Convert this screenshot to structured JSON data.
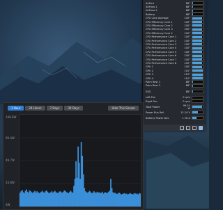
{
  "sensors_panel": {
    "rows": [
      {
        "label": "AirPort",
        "value": "88°",
        "level": 0.05
      },
      {
        "label": "AirFlow 1",
        "value": "88°",
        "level": 0.05
      },
      {
        "label": "AirFlow 2",
        "value": "88°",
        "level": 0.05
      },
      {
        "label": "Battery",
        "value": "88°",
        "level": 0.05
      },
      {
        "label": "CPU Core Average",
        "value": "100°",
        "level": 0.95
      },
      {
        "label": "CPU Efficiency Core 1",
        "value": "100°",
        "level": 0.95
      },
      {
        "label": "CPU Efficiency Core 2",
        "value": "100°",
        "level": 0.95
      },
      {
        "label": "CPU Efficiency Core 3",
        "value": "100°",
        "level": 0.95
      },
      {
        "label": "CPU Efficiency Core 4",
        "value": "100°",
        "level": 0.95
      },
      {
        "label": "CPU Performance Core 1",
        "value": "100°",
        "level": 0.95
      },
      {
        "label": "CPU Performance Core 2",
        "value": "100°",
        "level": 0.95
      },
      {
        "label": "CPU Performance Core 3",
        "value": "100°",
        "level": 0.95
      },
      {
        "label": "CPU Performance Core 4",
        "value": "100°",
        "level": 0.95
      },
      {
        "label": "CPU Performance Core 5",
        "value": "100°",
        "level": 0.95
      },
      {
        "label": "CPU Performance Core 6",
        "value": "100°",
        "level": 0.95
      },
      {
        "label": "CPU Performance Core 7",
        "value": "100°",
        "level": 0.95
      },
      {
        "label": "CPU Performance Core 8",
        "value": "100°",
        "level": 0.95
      },
      {
        "label": "GPU 1",
        "value": "100°",
        "level": 0.95
      },
      {
        "label": "GPU 2",
        "value": "110°",
        "level": 1.0
      },
      {
        "label": "GPU 3",
        "value": "110°",
        "level": 1.0
      },
      {
        "label": "GPU 4",
        "value": "110°",
        "level": 1.0
      },
      {
        "label": "Palm Rest 1",
        "value": "88°",
        "level": 0.05
      },
      {
        "label": "Palm Rest 2",
        "value": "88°",
        "level": 0.05
      },
      {
        "label": "SSD",
        "value": "88°",
        "level": 0.05
      },
      {
        "label": "Left Fan",
        "value": "0 rpm",
        "level": 0.0
      },
      {
        "label": "Right Fan",
        "value": "0 rpm",
        "level": 0.0
      },
      {
        "label": "Total Power",
        "value": "99.51 W",
        "level": 0.9
      },
      {
        "label": "Power Bus Rail",
        "value": "12.24 V",
        "level": 0.5
      },
      {
        "label": "Battery Power Bus",
        "value": "1.78 A",
        "level": 0.4
      }
    ]
  },
  "graph_window": {
    "tabs": [
      {
        "label": "1 Hour",
        "active": true
      },
      {
        "label": "24 Hours",
        "active": false
      },
      {
        "label": "7 Days",
        "active": false
      },
      {
        "label": "30 Days",
        "active": false
      }
    ],
    "hide_button": "Hide This Sensor",
    "y_ticks": [
      "198.8W",
      "99.4W",
      "49.7W",
      "24.8W",
      "0W"
    ]
  },
  "chart_data": {
    "type": "area",
    "title": "",
    "xlabel": "",
    "ylabel": "",
    "ylim": [
      0,
      198.8
    ],
    "color": "#3b8fd8",
    "values": [
      30,
      33,
      36,
      31,
      29,
      34,
      37,
      32,
      30,
      35,
      33,
      31,
      29,
      32,
      34,
      30,
      33,
      31,
      29,
      30,
      32,
      34,
      31,
      30,
      33,
      35,
      32,
      30,
      29,
      31,
      33,
      30,
      32,
      34,
      31,
      30,
      29,
      32,
      33,
      31,
      30,
      32,
      35,
      33,
      31,
      30,
      29,
      32,
      34,
      31,
      30,
      45,
      60,
      98,
      62,
      130,
      95,
      60,
      140,
      110,
      70,
      40,
      33,
      31,
      30,
      32,
      34,
      31,
      29,
      30,
      33,
      31,
      29,
      32,
      30,
      31,
      29,
      30,
      32,
      28,
      30,
      31,
      29,
      30,
      32,
      35,
      60,
      40,
      31,
      29,
      30,
      28,
      27,
      29,
      30,
      28,
      26,
      27,
      28,
      29,
      27,
      28,
      26,
      27,
      29,
      28,
      27,
      26,
      28,
      29,
      27,
      28,
      26,
      29,
      28,
      27
    ]
  }
}
